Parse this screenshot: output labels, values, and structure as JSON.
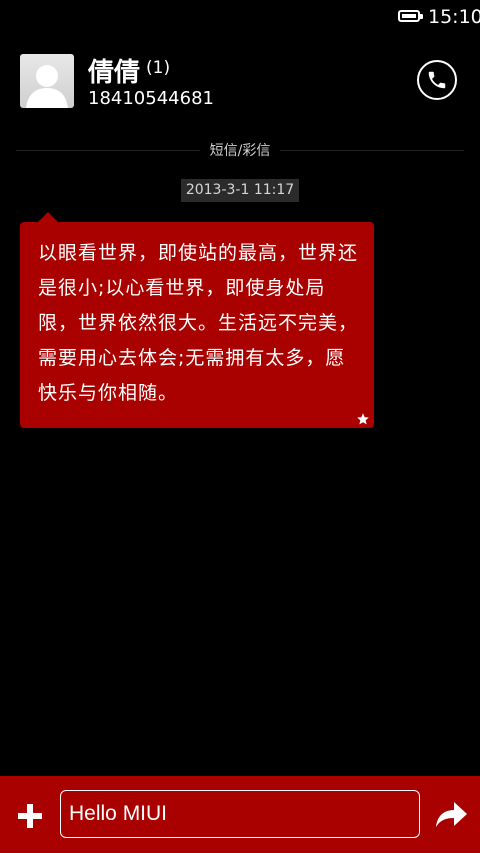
{
  "status_bar": {
    "time": "15:10",
    "battery_icon": "battery-icon"
  },
  "contact": {
    "name": "倩倩",
    "unread_count": "(1)",
    "phone": "18410544681"
  },
  "header": {
    "call_icon": "phone-icon"
  },
  "thread": {
    "message_type_label": "短信/彩信"
  },
  "messages": [
    {
      "timestamp": "2013-3-1 11:17",
      "text": "以眼看世界，即使站的最高，世界还是很小;以心看世界，即使身处局限，世界依然很大。生活远不完美，需要用心去体会;无需拥有太多，愿快乐与你相随。",
      "starred_icon": "star-icon"
    }
  ],
  "compose": {
    "value": "Hello MIUI",
    "add_icon": "plus-icon",
    "send_icon": "send-arrow-icon"
  },
  "colors": {
    "accent": "#a90000",
    "background": "#000000"
  }
}
